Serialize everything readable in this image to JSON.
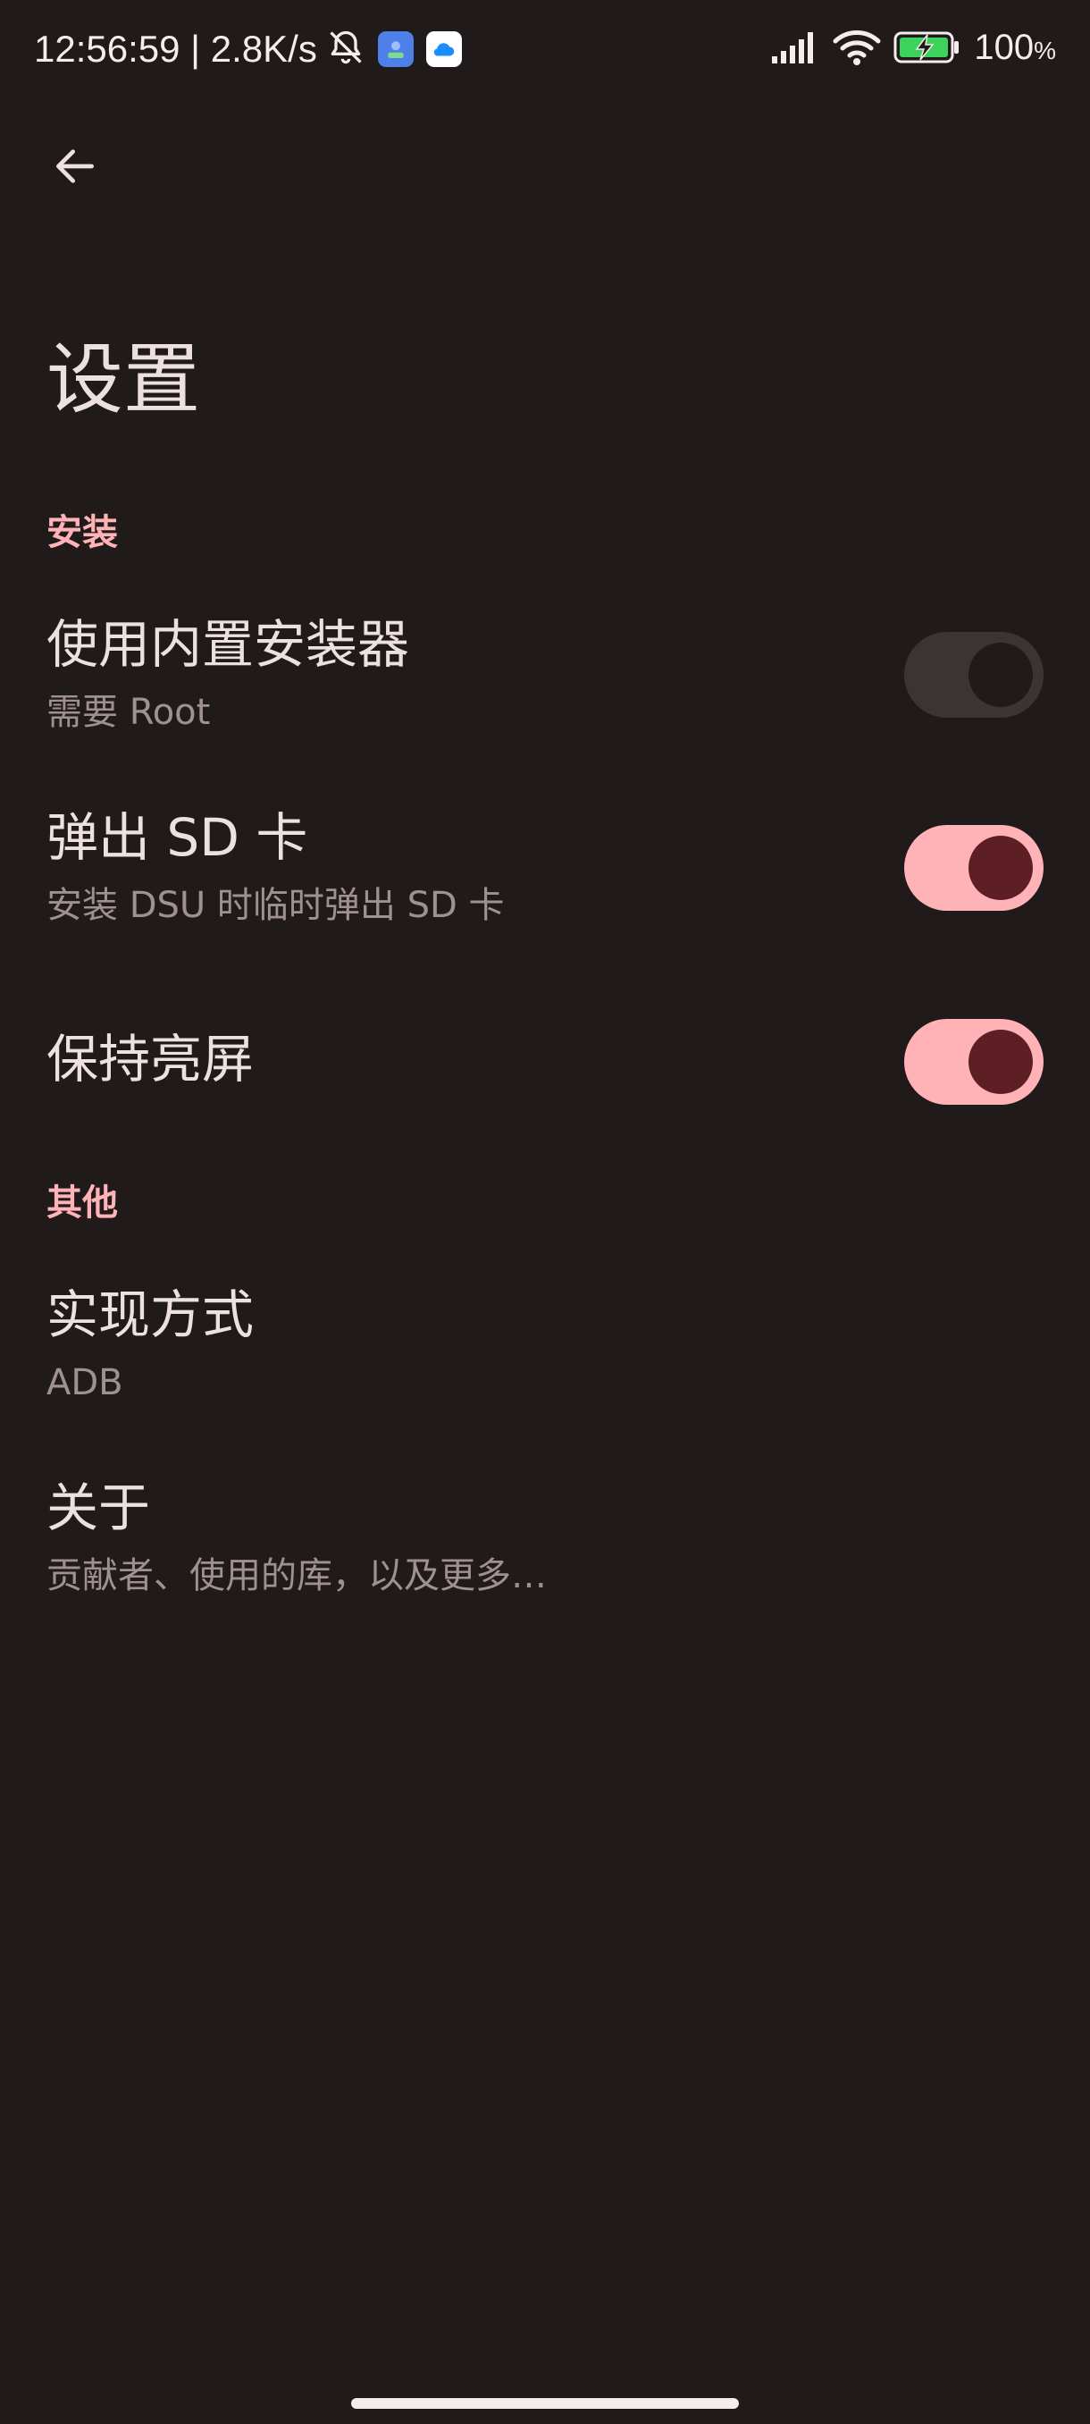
{
  "status_bar": {
    "time": "12:56:59",
    "separator": " | ",
    "net_speed": "2.8K/s",
    "battery_value": "100",
    "battery_unit": "%"
  },
  "app_bar": {
    "title": "设置"
  },
  "sections": {
    "install": {
      "header": "安装",
      "builtin_installer": {
        "title": "使用内置安装器",
        "summary": "需要 Root",
        "enabled": false
      },
      "eject_sd": {
        "title": "弹出 SD 卡",
        "summary": "安装 DSU 时临时弹出 SD 卡",
        "enabled": true
      },
      "keep_screen_on": {
        "title": "保持亮屏",
        "enabled": true
      }
    },
    "other": {
      "header": "其他",
      "implementation": {
        "title": "实现方式",
        "summary": "ADB"
      },
      "about": {
        "title": "关于",
        "summary": "贡献者、使用的库，以及更多…"
      }
    }
  },
  "colors": {
    "background": "#201a1b",
    "accent": "#ffb3b7",
    "switch_thumb_on": "#5d1f24",
    "switch_track_off": "#3b3435",
    "primary_text": "#ece0e1",
    "secondary_text": "#9f9192"
  },
  "icons": {
    "back": "arrow-back-icon",
    "mute": "bell-off-icon",
    "signal": "cell-signal-icon",
    "wifi": "wifi-icon",
    "battery": "battery-charging-icon"
  }
}
